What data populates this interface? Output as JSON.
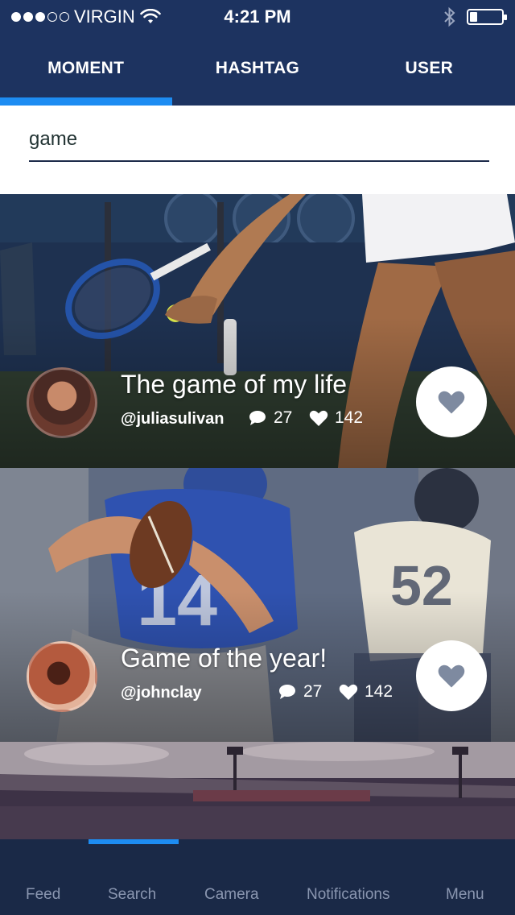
{
  "status_bar": {
    "carrier": "VIRGIN",
    "time": "4:21 PM",
    "signal_dots_filled": 3,
    "signal_dots_total": 5
  },
  "tabs": [
    {
      "label": "MOMENT",
      "active": true
    },
    {
      "label": "HASHTAG",
      "active": false
    },
    {
      "label": "USER",
      "active": false
    }
  ],
  "search": {
    "value": "game",
    "placeholder": ""
  },
  "cards": [
    {
      "title": "The game of my life",
      "user": "@juliasulivan",
      "comments": "27",
      "likes": "142"
    },
    {
      "title": "Game of the year!",
      "user": "@johnclay",
      "comments": "27",
      "likes": "142"
    }
  ],
  "bottom_nav": {
    "items": [
      "Feed",
      "Search",
      "Camera",
      "Notifications",
      "Menu"
    ],
    "active": "Search"
  },
  "colors": {
    "navy": "#1d3360",
    "accent": "#1d8cf2",
    "nav_bg": "#1a2947",
    "nav_text": "#8a96b0"
  }
}
